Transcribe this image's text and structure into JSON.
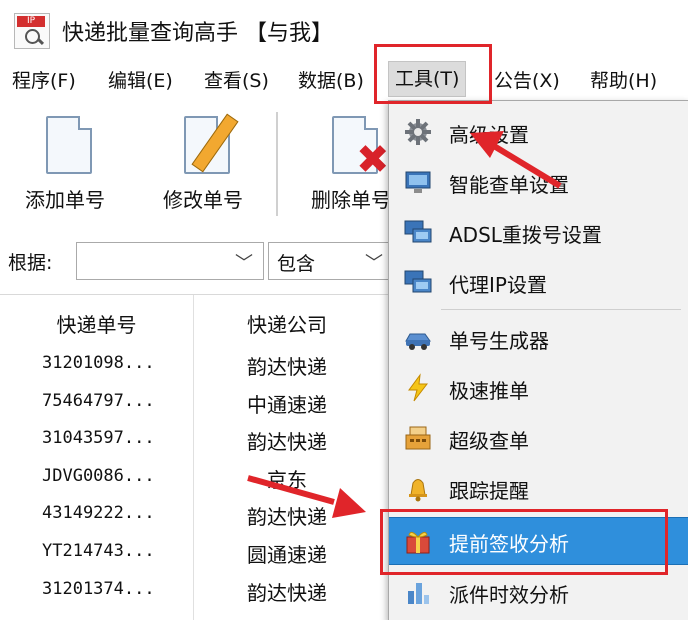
{
  "window": {
    "title": "快递批量查询高手 【与我】",
    "logo_text": "IP"
  },
  "menu": {
    "items": [
      "程序(F)",
      "编辑(E)",
      "查看(S)",
      "数据(B)",
      "工具(T)",
      "公告(X)",
      "帮助(H)"
    ],
    "active": "工具(T)"
  },
  "toolbar": {
    "add_label": "添加单号",
    "edit_label": "修改单号",
    "delete_label": "删除单号"
  },
  "filter": {
    "label": "根据:",
    "field_value": "",
    "mode_value": "包含"
  },
  "table": {
    "columns": [
      "快递单号",
      "快递公司"
    ],
    "rows": [
      [
        "31201098...",
        "韵达快递"
      ],
      [
        "75464797...",
        "中通速递"
      ],
      [
        "31043597...",
        "韵达快递"
      ],
      [
        "JDVG0086...",
        "京东"
      ],
      [
        "43149222...",
        "韵达快递"
      ],
      [
        "YT214743...",
        "圆通速递"
      ],
      [
        "31201374...",
        "韵达快递"
      ]
    ]
  },
  "tools_menu": {
    "items": [
      {
        "label": "高级设置",
        "icon": "gear-icon"
      },
      {
        "label": "智能查单设置",
        "icon": "monitor-icon"
      },
      {
        "label": "ADSL重拨号设置",
        "icon": "network-computer-icon"
      },
      {
        "label": "代理IP设置",
        "icon": "network-computer-icon"
      },
      {
        "label": "单号生成器",
        "icon": "car-icon"
      },
      {
        "label": "极速推单",
        "icon": "lightning-icon"
      },
      {
        "label": "超级查单",
        "icon": "cash-register-icon"
      },
      {
        "label": "跟踪提醒",
        "icon": "bell-icon"
      },
      {
        "label": "提前签收分析",
        "icon": "gift-box-icon"
      },
      {
        "label": "派件时效分析",
        "icon": "bar-chart-icon"
      }
    ],
    "highlighted": "提前签收分析"
  },
  "colors": {
    "highlight": "#2f8fdc",
    "annotation_red": "#e0252a"
  }
}
